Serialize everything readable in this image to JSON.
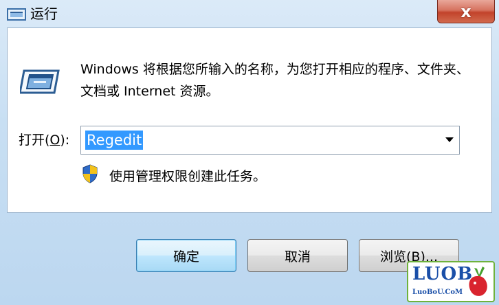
{
  "window": {
    "title": "运行",
    "close_label": "x"
  },
  "icons": {
    "app": "run-app-icon",
    "main": "run-dialog-icon",
    "shield": "uac-shield-icon",
    "dropdown": "chevron-down-icon"
  },
  "description": "Windows 将根据您所输入的名称，为您打开相应的程序、文件夹、文档或 Internet 资源。",
  "open_field": {
    "label_prefix": "打开(",
    "label_accel": "O",
    "label_suffix": "):",
    "value": "Regedit"
  },
  "admin_note": "使用管理权限创建此任务。",
  "buttons": {
    "ok": "确定",
    "cancel": "取消",
    "browse": "浏览(B)..."
  },
  "watermark": {
    "logo": "LUOB",
    "url": "LuoBoU.CoM"
  },
  "colors": {
    "selection": "#3399ff",
    "close_button": "#c2432b",
    "default_button_border": "#3c7fb1"
  }
}
